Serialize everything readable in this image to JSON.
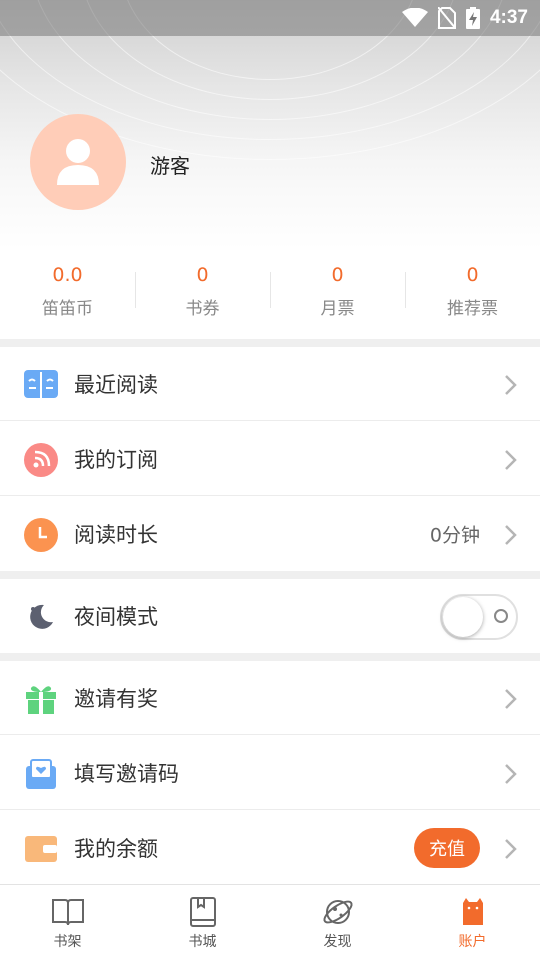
{
  "status_bar": {
    "time": "4:37"
  },
  "profile": {
    "username": "游客"
  },
  "stats": [
    {
      "value": "0.0",
      "label": "笛笛币"
    },
    {
      "value": "0",
      "label": "书券"
    },
    {
      "value": "0",
      "label": "月票"
    },
    {
      "value": "0",
      "label": "推荐票"
    }
  ],
  "menu": {
    "recent_reading": {
      "label": "最近阅读",
      "icon": "open-book-icon"
    },
    "my_subscription": {
      "label": "我的订阅",
      "icon": "rss-icon"
    },
    "reading_time": {
      "label": "阅读时长",
      "value": "0分钟",
      "icon": "clock-icon"
    },
    "night_mode": {
      "label": "夜间模式",
      "icon": "moon-icon",
      "enabled": false
    },
    "invite_reward": {
      "label": "邀请有奖",
      "icon": "gift-icon"
    },
    "invite_code": {
      "label": "填写邀请码",
      "icon": "heart-envelope-icon"
    },
    "balance": {
      "label": "我的余额",
      "button": "充值",
      "icon": "wallet-icon"
    }
  },
  "tabs": [
    {
      "label": "书架",
      "icon": "bookshelf-icon",
      "active": false
    },
    {
      "label": "书城",
      "icon": "bookstore-icon",
      "active": false
    },
    {
      "label": "发现",
      "icon": "planet-icon",
      "active": false
    },
    {
      "label": "账户",
      "icon": "account-icon",
      "active": true
    }
  ],
  "colors": {
    "accent": "#f26b2c",
    "avatar_bg": "#ffcdb8"
  }
}
